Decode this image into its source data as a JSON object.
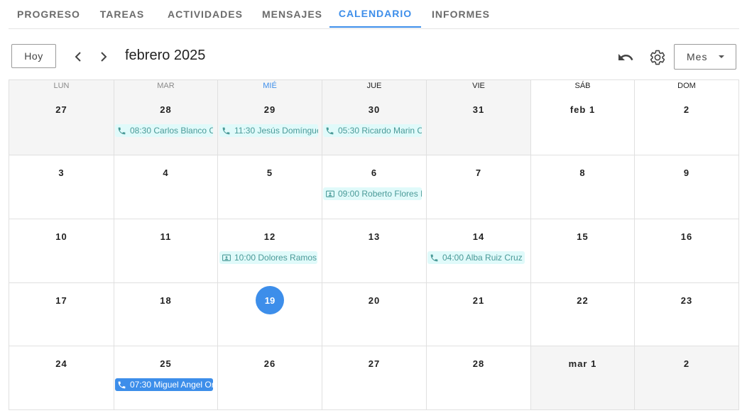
{
  "tabs": [
    "PROGRESO",
    "TAREAS",
    "ACTIVIDADES",
    "MENSAJES",
    "CALENDARIO",
    "INFORMES"
  ],
  "toolbar": {
    "today_label": "Hoy",
    "title": "febrero 2025",
    "view_label": "Mes"
  },
  "weekdays": [
    "LUN",
    "MAR",
    "MIÉ",
    "JUE",
    "VIE",
    "SÁB",
    "DOM"
  ],
  "weeks": [
    [
      "27",
      "28",
      "29",
      "30",
      "31",
      "feb 1",
      "2"
    ],
    [
      "3",
      "4",
      "5",
      "6",
      "7",
      "8",
      "9"
    ],
    [
      "10",
      "11",
      "12",
      "13",
      "14",
      "15",
      "16"
    ],
    [
      "17",
      "18",
      "19",
      "20",
      "21",
      "22",
      "23"
    ],
    [
      "24",
      "25",
      "26",
      "27",
      "28",
      "mar 1",
      "2"
    ]
  ],
  "today": "19",
  "events": {
    "jan28": "08:30 Carlos Blanco C",
    "jan29": "11:30 Jesús Domíngue",
    "jan30": "05:30 Ricardo Marin C",
    "feb6": "09:00 Roberto Flores L",
    "feb12": "10:00 Dolores Ramos",
    "feb14": "04:00 Alba Ruiz Cruz",
    "feb25": "07:30 Miguel Angel Or"
  },
  "colors": {
    "accent": "#3d8eea",
    "event_bg": "#e0fafa",
    "event_text": "#4a9a98",
    "outside_month_bg": "#f5f5f5"
  }
}
